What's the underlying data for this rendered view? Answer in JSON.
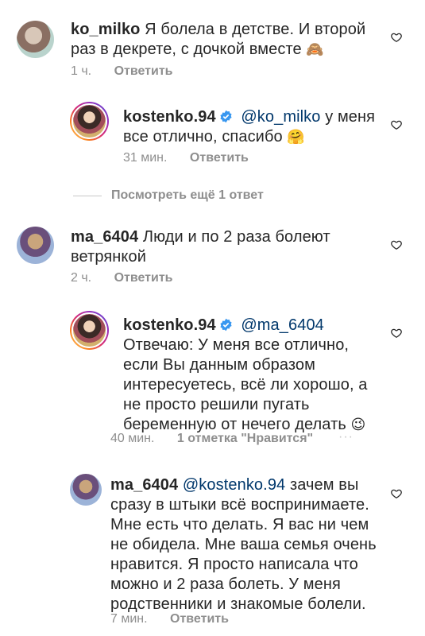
{
  "comments": [
    {
      "username": "ko_milko",
      "text": "Я болела в детстве. И второй раз в декрете, с дочкой вместе",
      "emoji": "🙈",
      "time": "1 ч.",
      "reply_label": "Ответить"
    },
    {
      "username": "kostenko.94",
      "verified": true,
      "mention": "@ko_milko",
      "text": "у меня все отлично, спасибо",
      "emoji": "🤗",
      "time": "31 мин.",
      "reply_label": "Ответить"
    },
    {
      "username": "ma_6404",
      "text": "Люди и по 2 раза болеют ветрянкой",
      "time": "2 ч.",
      "reply_label": "Ответить"
    },
    {
      "username": "kostenko.94",
      "verified": true,
      "mention": "@ma_6404",
      "text": "Отвечаю: У меня все отлично, если Вы данным образом интересуетесь, всё ли хорошо, а не просто решили пугать беременную от нечего делать",
      "emoji": "😉",
      "time": "40 мин.",
      "likes_label": "1 отметка \"Нравится\"",
      "more_label": "···"
    },
    {
      "username": "ma_6404",
      "mention": "@kostenko.94",
      "text": "зачем вы сразу в штыки всё воспринимаете. Мне есть что делать. Я вас ни чем не обидела. Мне ваша семья очень нравится. Я просто написала что можно и 2 раза болеть. У меня родственники и знакомые болели.",
      "time": "7 мин.",
      "reply_label": "Ответить"
    }
  ],
  "view_more_replies": "Посмотреть ещё 1 ответ",
  "colors": {
    "text": "#262626",
    "meta": "#8e8e8e",
    "mention": "#00376b",
    "verified": "#3897f0"
  }
}
